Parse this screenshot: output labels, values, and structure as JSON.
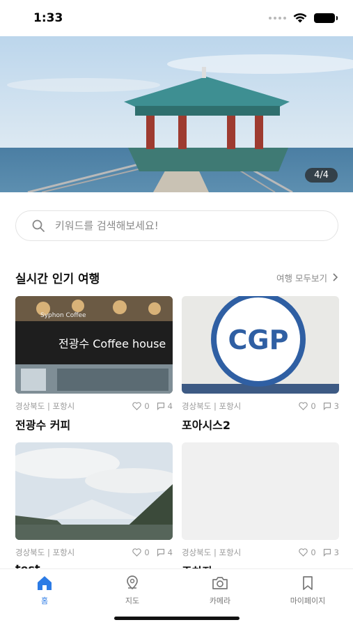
{
  "status_bar": {
    "time": "1:33"
  },
  "hero": {
    "counter": "4/4",
    "icon": "pavilion-photo"
  },
  "search": {
    "placeholder": "키워드를 검색해보세요!",
    "value": "",
    "icon": "search-icon"
  },
  "popular": {
    "title": "실시간 인기 여행",
    "view_all_label": "여행 모두보기",
    "cards": [
      {
        "location": "경상북도 | 포항시",
        "likes": "0",
        "comments": "4",
        "title": "전광수 커피",
        "image": "coffee-shop-photo"
      },
      {
        "location": "경상북도 | 포항시",
        "likes": "0",
        "comments": "3",
        "title": "포아시스2",
        "image": "cgp-logo-photo"
      },
      {
        "location": "경상북도 | 포항시",
        "likes": "0",
        "comments": "4",
        "title": "test",
        "image": "mountain-photo"
      },
      {
        "location": "경상북도 | 포항시",
        "likes": "0",
        "comments": "3",
        "title": "주차장",
        "image": "blank-photo"
      }
    ]
  },
  "nav": {
    "items": [
      {
        "label": "홈",
        "icon": "home-icon",
        "active": true
      },
      {
        "label": "지도",
        "icon": "map-pin-icon",
        "active": false
      },
      {
        "label": "카메라",
        "icon": "camera-icon",
        "active": false
      },
      {
        "label": "마이페이지",
        "icon": "bookmark-icon",
        "active": false
      }
    ]
  },
  "colors": {
    "accent": "#2c7be5",
    "muted": "#9a9a9a",
    "border": "#e3e3e3"
  },
  "cgp_text": "CGP",
  "sign_text": "전광수 Coffee house",
  "sign_small_text": "Syphon Coffee"
}
